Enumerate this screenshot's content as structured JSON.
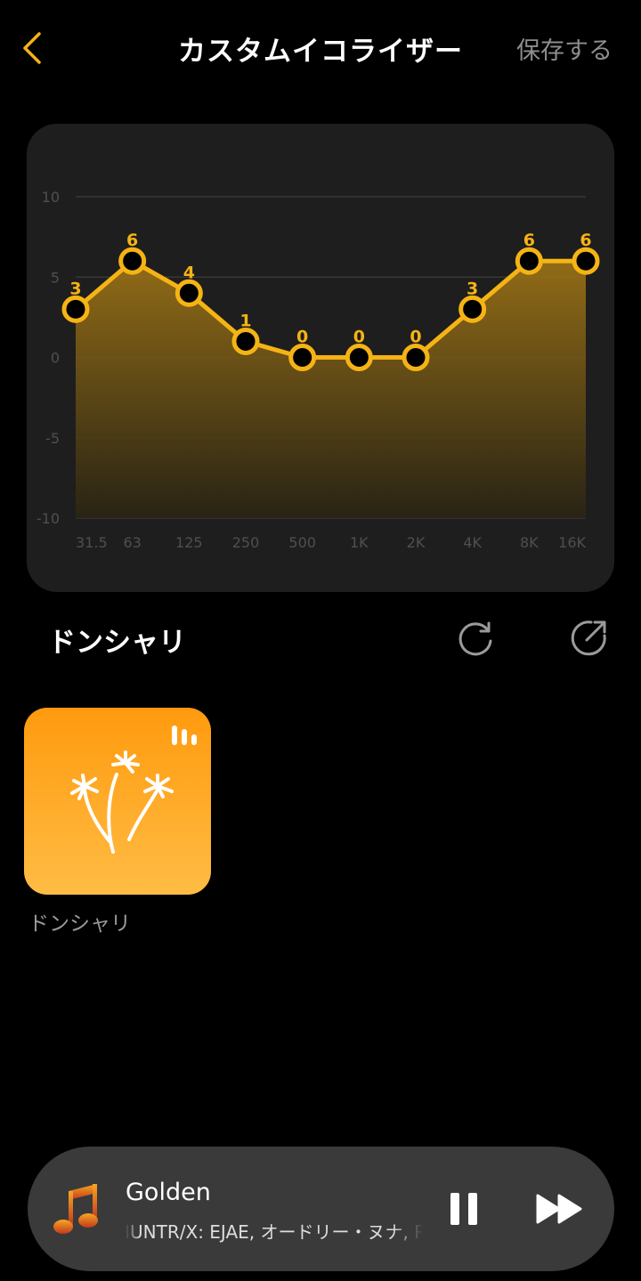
{
  "header": {
    "title": "カスタムイコライザー",
    "save_label": "保存する",
    "back_icon": "chevron-left-icon",
    "accent_color": "#f5b315"
  },
  "chart_data": {
    "type": "line",
    "categories": [
      "31.5",
      "63",
      "125",
      "250",
      "500",
      "1K",
      "2K",
      "4K",
      "8K",
      "16K"
    ],
    "values": [
      3,
      6,
      4,
      1,
      0,
      0,
      0,
      3,
      6,
      6
    ],
    "y_ticks": [
      "10",
      "5",
      "0",
      "-5",
      "-10"
    ],
    "ylim": [
      -10,
      10
    ],
    "grid": true,
    "line_color": "#f5b315",
    "area_fill": "gradient-gold"
  },
  "preset": {
    "name": "ドンシャリ",
    "reset_icon": "refresh-icon",
    "share_icon": "share-icon"
  },
  "presets": [
    {
      "label": "ドンシャリ",
      "icon": "fireworks-icon",
      "active": true,
      "active_indicator": "equalizer-bars-icon"
    }
  ],
  "player": {
    "title": "Golden",
    "artist": "HUNTR/X: EJAE, オードリー・ヌナ, REI AMI & KPop Demon Hunters Cast",
    "state": "playing",
    "pause_icon": "pause-icon",
    "next_icon": "fast-forward-icon",
    "art_icon": "music-note-icon"
  }
}
